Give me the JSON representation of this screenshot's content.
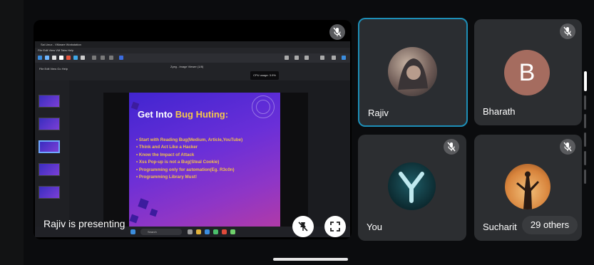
{
  "presentation": {
    "presenter_label": "Rajiv is presenting",
    "window_title": "Sai Linux - VMware Workstation",
    "window_menu": "File  Edit  View  VM  Tabs  Help",
    "app_menu": "File  Edit  View  Go  Help",
    "app_title": "Zyeg - Image Viewer (1/8)",
    "cpu_badge": "CPU usage: 3.9%",
    "taskbar_search": "Search",
    "slide": {
      "title_main": "Get Into ",
      "title_accent": "Bug Huting:",
      "bullets": [
        "• Start with Reading Bug(Medium, Article,YouTube)",
        "• Think and Act Like a Hacker",
        "• Know the Impact of Attack",
        "• Xss Pop-up is not a Bug(Steal Cookie)",
        "• Programming only for automation(Eg. R3c0n)",
        "• Programming Library Must!"
      ]
    },
    "accent_color": "#f6c84a"
  },
  "participants": [
    {
      "name": "Rajiv",
      "active": true,
      "avatar": "photo-avatar-hooded",
      "muted": false
    },
    {
      "name": "Bharath",
      "active": false,
      "avatar_letter": "B",
      "muted": true
    },
    {
      "name": "You",
      "active": false,
      "avatar": "photo-avatar-y-logo",
      "muted": true
    },
    {
      "name": "Sucharit",
      "active": false,
      "avatar": "photo-avatar-silhouette",
      "muted": true
    }
  ],
  "others_count_label": "29 others",
  "icons": {
    "mic_off": "mic-off-icon",
    "pin_off": "pin-off-icon",
    "fullscreen": "fullscreen-icon"
  },
  "colors": {
    "active_border": "#1d8fb8",
    "tile_bg": "#2c2e31",
    "avatar_b": "#a56c5f"
  }
}
